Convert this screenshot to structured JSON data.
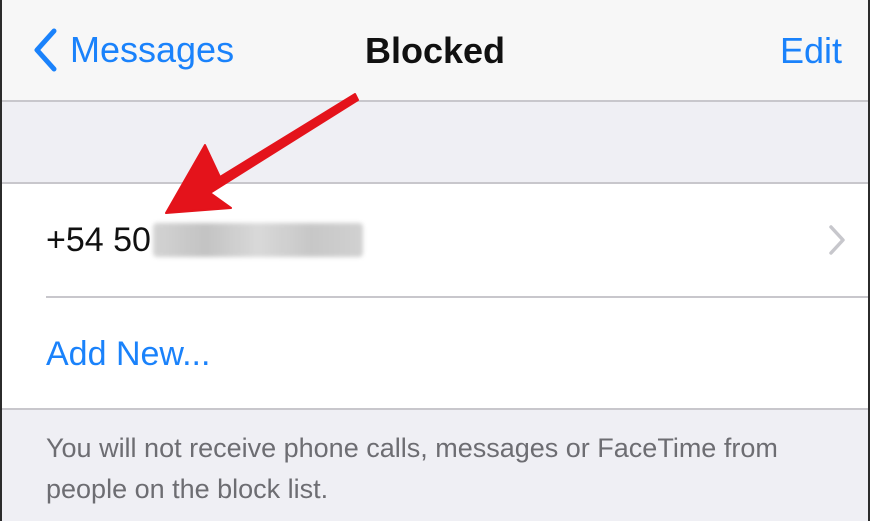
{
  "navbar": {
    "back_label": "Messages",
    "title": "Blocked",
    "edit_label": "Edit"
  },
  "blocked_list": {
    "items": [
      {
        "number": "+54 50"
      }
    ],
    "add_new_label": "Add New..."
  },
  "footer": {
    "text": "You will not receive phone calls, messages or FaceTime from people on the block list."
  },
  "icons": {
    "back": "chevron-left-icon",
    "disclosure": "chevron-right-icon",
    "annotation": "red-arrow-annotation"
  },
  "colors": {
    "accent": "#1a82fb",
    "annotation_arrow": "#e4131b",
    "background": "#efeff4",
    "separator": "#c8c7cc"
  }
}
